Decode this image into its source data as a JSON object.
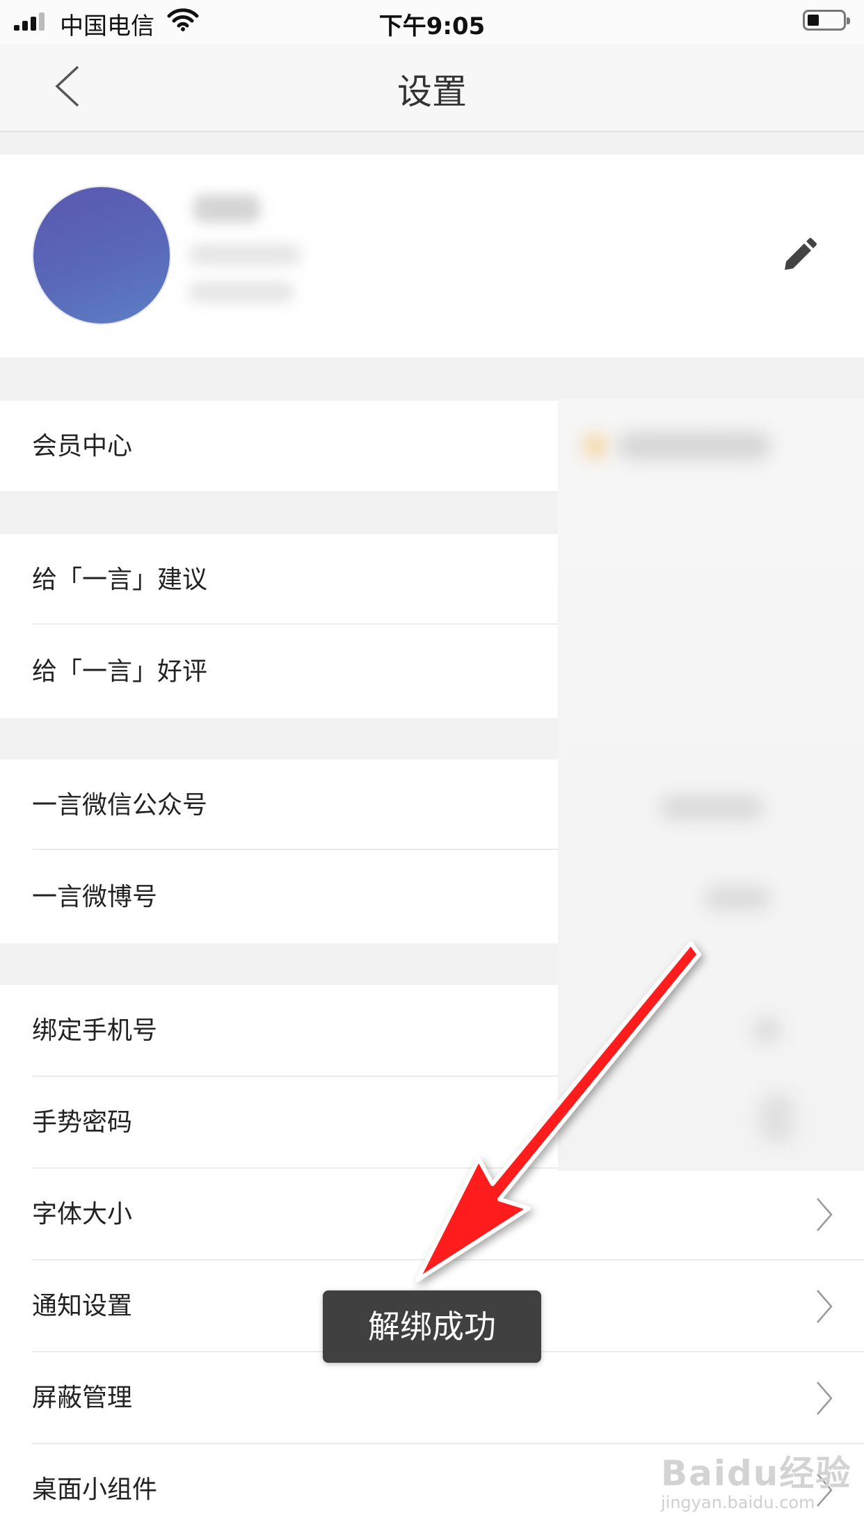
{
  "status_bar": {
    "carrier": "中国电信",
    "time": "下午9:05"
  },
  "nav": {
    "title": "设置",
    "back_icon": "chevron-left-icon"
  },
  "profile": {
    "edit_icon": "pencil-icon",
    "avatar_colors": [
      "#5a58b0",
      "#5c80c6"
    ]
  },
  "settings": {
    "member_center": "会员中心",
    "feedback": "给「一言」建议",
    "rate": "给「一言」好评",
    "wechat": "一言微信公众号",
    "weibo": "一言微博号",
    "bind_phone": "绑定手机号",
    "gesture_password": "手势密码",
    "font_size": "字体大小",
    "notification": "通知设置",
    "block": "屏蔽管理",
    "widget": "桌面小组件"
  },
  "toast": {
    "message": "解绑成功"
  },
  "annotation": {
    "arrow_color": "#ff1a1a"
  },
  "watermark": {
    "brand": "Baidu经验",
    "url": "jingyan.baidu.com"
  }
}
